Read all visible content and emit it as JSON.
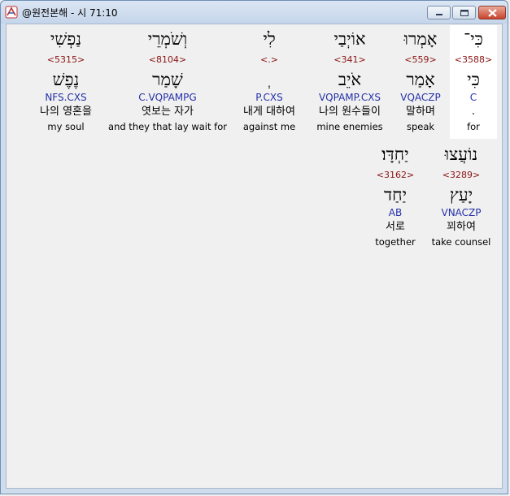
{
  "window": {
    "title": "@원전본해 - 시 71:10"
  },
  "words": [
    {
      "hebrew": "כִּי־",
      "strong": "<3588>",
      "lemma": "כִּי",
      "morph": "C",
      "korean": ".",
      "english": "for",
      "selected": true
    },
    {
      "hebrew": "אָמְרוּ",
      "strong": "<559>",
      "lemma": "אָמַר",
      "morph": "VQACZP",
      "korean": "말하며",
      "english": "speak"
    },
    {
      "hebrew": "אוֹיְבַי",
      "strong": "<341>",
      "lemma": "אֹיֵב",
      "morph": "VQPAMP.CXS",
      "korean": "나의 원수들이",
      "english": "mine enemies"
    },
    {
      "hebrew": "לִי",
      "strong": "<.>",
      "lemma": "ְ",
      "morph": "P.CXS",
      "korean": "내게 대하여",
      "english": "against me"
    },
    {
      "hebrew": "וְשֹׁמְרֵי",
      "strong": "<8104>",
      "lemma": "שָׁמַר",
      "morph": "C.VQPAMPG",
      "korean": "엿보는 자가",
      "english": "and they that lay wait for"
    },
    {
      "hebrew": "נַפְשִׁי",
      "strong": "<5315>",
      "lemma": "נֶפֶשׁ",
      "morph": "NFS.CXS",
      "korean": "나의 영혼을",
      "english": "my soul"
    },
    {
      "hebrew": "נוֹעֲצוּ",
      "strong": "<3289>",
      "lemma": "יָעַץ",
      "morph": "VNACZP",
      "korean": "꾀하여",
      "english": "take counsel"
    },
    {
      "hebrew": "יַחְדָּו׃",
      "strong": "<3162>",
      "lemma": "יַחַד",
      "morph": "AB",
      "korean": "서로",
      "english": "together"
    }
  ],
  "icons": {
    "app": "app-logo-icon",
    "minimize": "minimize-icon",
    "maximize": "maximize-icon",
    "close": "close-icon"
  }
}
